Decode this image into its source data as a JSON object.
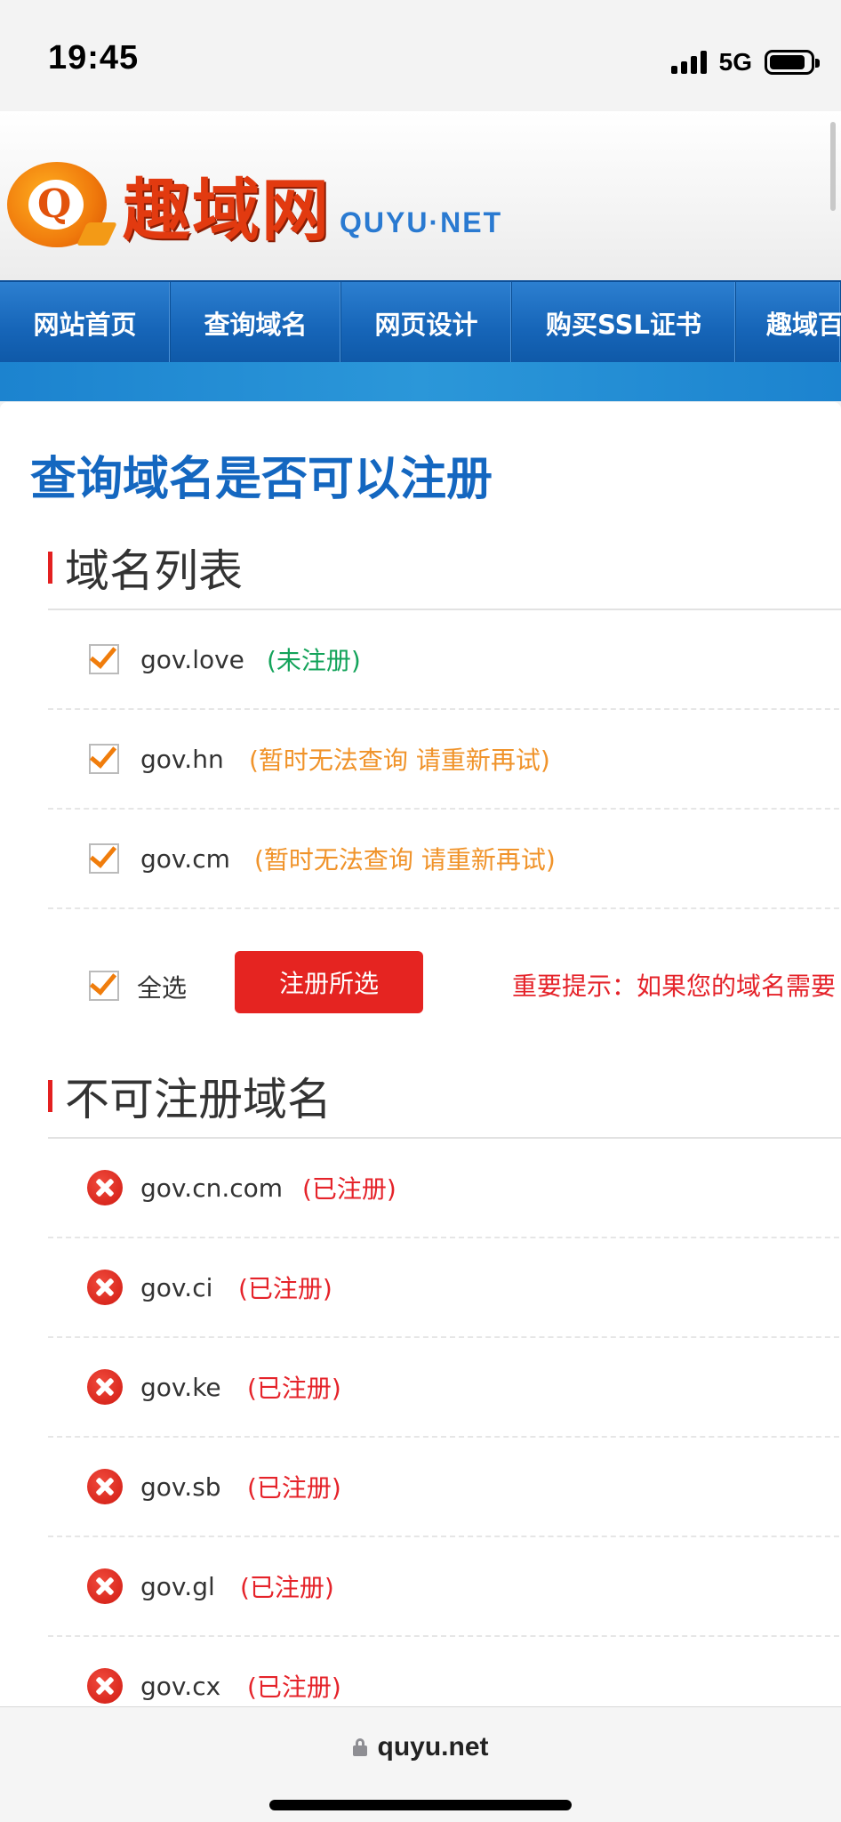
{
  "status_bar": {
    "time": "19:45",
    "network": "5G"
  },
  "site": {
    "logo_cn": "趣域网",
    "logo_en": "QUYU·NET",
    "logo_letter": "Q"
  },
  "nav": {
    "items": [
      {
        "label": "网站首页"
      },
      {
        "label": "查询域名"
      },
      {
        "label": "网页设计"
      },
      {
        "label": "购买SSL证书"
      },
      {
        "label": "趣域百"
      }
    ]
  },
  "page": {
    "title": "查询域名是否可以注册"
  },
  "available": {
    "heading": "域名列表",
    "rows": [
      {
        "domain": "gov.love",
        "status": "(未注册)",
        "checked": true
      },
      {
        "domain": "gov.hn",
        "status": "(暂时无法查询 请重新再试)",
        "checked": true
      },
      {
        "domain": "gov.cm",
        "status": "(暂时无法查询 请重新再试)",
        "checked": true
      }
    ],
    "select_all_label": "全选",
    "register_button": "注册所选",
    "notice": "重要提示：如果您的域名需要"
  },
  "unavailable": {
    "heading": "不可注册域名",
    "rows": [
      {
        "domain": "gov.cn.com",
        "status": "(已注册)"
      },
      {
        "domain": "gov.ci",
        "status": "(已注册)"
      },
      {
        "domain": "gov.ke",
        "status": "(已注册)"
      },
      {
        "domain": "gov.sb",
        "status": "(已注册)"
      },
      {
        "domain": "gov.gl",
        "status": "(已注册)"
      },
      {
        "domain": "gov.cx",
        "status": "(已注册)"
      }
    ]
  },
  "browser": {
    "url": "quyu.net"
  },
  "colors": {
    "brand_blue": "#1467c0",
    "accent_red": "#e52421",
    "check_orange": "#f07d0c",
    "available_green": "#13a35a",
    "pending_orange": "#f0932a"
  }
}
